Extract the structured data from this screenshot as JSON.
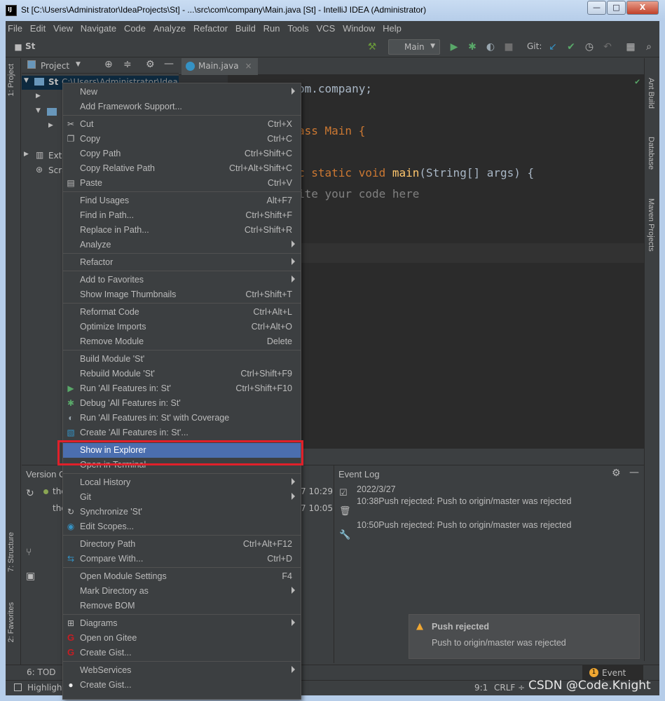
{
  "window": {
    "title": "St [C:\\Users\\Administrator\\IdeaProjects\\St] - ...\\src\\com\\company\\Main.java [St] - IntelliJ IDEA (Administrator)",
    "minimize": "—",
    "maximize": "□",
    "close": "X"
  },
  "menubar": [
    "File",
    "Edit",
    "View",
    "Navigate",
    "Code",
    "Analyze",
    "Refactor",
    "Build",
    "Run",
    "Tools",
    "VCS",
    "Window",
    "Help"
  ],
  "toolbar": {
    "project_name": "St",
    "run_config": "Main",
    "git_label": "Git:"
  },
  "left_stripe": {
    "project_tab": "1: Project",
    "structure_tab": "7: Structure",
    "favorites_tab": "2: Favorites"
  },
  "right_stripe": {
    "ant_build": "Ant Build",
    "database": "Database",
    "maven": "Maven Projects"
  },
  "project_pane": {
    "title": "Project",
    "root_label": "St",
    "root_path": "C:\\Users\\Administrator\\IdeaP",
    "external": "Exte",
    "scratches": "Scra"
  },
  "editor": {
    "tab_label": "Main.java",
    "line1": "om.company;",
    "line2": "ass Main {",
    "line3_a": "c static void ",
    "line3_fn": "main",
    "line3_b": "(String[] args) {",
    "line4": "ite your code here"
  },
  "vcs_pane": {
    "title": "Version C",
    "row1": "the",
    "row2": "the",
    "time1": "7 10:29",
    "time2": "7 10:05"
  },
  "event_log": {
    "title": "Event Log",
    "date": "2022/3/27",
    "entry1_time": "10:38",
    "entry1_msg": "Push rejected: Push to origin/master was rejected",
    "entry2_time": "10:50",
    "entry2_msg": "Push rejected: Push to origin/master was rejected"
  },
  "notification": {
    "title": "Push rejected",
    "message": "Push to origin/master was rejected"
  },
  "bottom_tabs": {
    "todo": "6: TOD",
    "event_log_badge": "1",
    "event_log": "Event Log"
  },
  "statusbar": {
    "highlight": "Highlight",
    "position": "9:1",
    "line_sep": "CRLF ÷"
  },
  "watermark": "CSDN @Code.Knight",
  "context_menu": {
    "items": [
      {
        "label": "New",
        "shortcut": "",
        "submenu": true,
        "icon": ""
      },
      {
        "label": "Add Framework Support...",
        "shortcut": "",
        "submenu": false,
        "icon": ""
      },
      {
        "label": "Cut",
        "shortcut": "Ctrl+X",
        "submenu": false,
        "icon": "scissors"
      },
      {
        "label": "Copy",
        "shortcut": "Ctrl+C",
        "submenu": false,
        "icon": "copy"
      },
      {
        "label": "Copy Path",
        "shortcut": "Ctrl+Shift+C",
        "submenu": false,
        "icon": ""
      },
      {
        "label": "Copy Relative Path",
        "shortcut": "Ctrl+Alt+Shift+C",
        "submenu": false,
        "icon": ""
      },
      {
        "label": "Paste",
        "shortcut": "Ctrl+V",
        "submenu": false,
        "icon": "paste"
      },
      {
        "label": "Find Usages",
        "shortcut": "Alt+F7",
        "submenu": false,
        "icon": ""
      },
      {
        "label": "Find in Path...",
        "shortcut": "Ctrl+Shift+F",
        "submenu": false,
        "icon": ""
      },
      {
        "label": "Replace in Path...",
        "shortcut": "Ctrl+Shift+R",
        "submenu": false,
        "icon": ""
      },
      {
        "label": "Analyze",
        "shortcut": "",
        "submenu": true,
        "icon": ""
      },
      {
        "label": "Refactor",
        "shortcut": "",
        "submenu": true,
        "icon": ""
      },
      {
        "label": "Add to Favorites",
        "shortcut": "",
        "submenu": true,
        "icon": ""
      },
      {
        "label": "Show Image Thumbnails",
        "shortcut": "Ctrl+Shift+T",
        "submenu": false,
        "icon": ""
      },
      {
        "label": "Reformat Code",
        "shortcut": "Ctrl+Alt+L",
        "submenu": false,
        "icon": ""
      },
      {
        "label": "Optimize Imports",
        "shortcut": "Ctrl+Alt+O",
        "submenu": false,
        "icon": ""
      },
      {
        "label": "Remove Module",
        "shortcut": "Delete",
        "submenu": false,
        "icon": ""
      },
      {
        "label": "Build Module 'St'",
        "shortcut": "",
        "submenu": false,
        "icon": ""
      },
      {
        "label": "Rebuild Module 'St'",
        "shortcut": "Ctrl+Shift+F9",
        "submenu": false,
        "icon": ""
      },
      {
        "label": "Run 'All Features in: St'",
        "shortcut": "Ctrl+Shift+F10",
        "submenu": false,
        "icon": "run"
      },
      {
        "label": "Debug 'All Features in: St'",
        "shortcut": "",
        "submenu": false,
        "icon": "debug"
      },
      {
        "label": "Run 'All Features in: St' with Coverage",
        "shortcut": "",
        "submenu": false,
        "icon": "coverage"
      },
      {
        "label": "Create 'All Features in: St'...",
        "shortcut": "",
        "submenu": false,
        "icon": "create"
      },
      {
        "label": "Show in Explorer",
        "shortcut": "",
        "submenu": false,
        "icon": "",
        "selected": true
      },
      {
        "label": "Open in Terminal",
        "shortcut": "",
        "submenu": false,
        "icon": ""
      },
      {
        "label": "Local History",
        "shortcut": "",
        "submenu": true,
        "icon": ""
      },
      {
        "label": "Git",
        "shortcut": "",
        "submenu": true,
        "icon": ""
      },
      {
        "label": "Synchronize 'St'",
        "shortcut": "",
        "submenu": false,
        "icon": "sync"
      },
      {
        "label": "Edit Scopes...",
        "shortcut": "",
        "submenu": false,
        "icon": "scope"
      },
      {
        "label": "Directory Path",
        "shortcut": "Ctrl+Alt+F12",
        "submenu": false,
        "icon": ""
      },
      {
        "label": "Compare With...",
        "shortcut": "Ctrl+D",
        "submenu": false,
        "icon": "compare"
      },
      {
        "label": "Open Module Settings",
        "shortcut": "F4",
        "submenu": false,
        "icon": ""
      },
      {
        "label": "Mark Directory as",
        "shortcut": "",
        "submenu": true,
        "icon": ""
      },
      {
        "label": "Remove BOM",
        "shortcut": "",
        "submenu": false,
        "icon": ""
      },
      {
        "label": "Diagrams",
        "shortcut": "",
        "submenu": true,
        "icon": "diagram"
      },
      {
        "label": "Open on Gitee",
        "shortcut": "",
        "submenu": false,
        "icon": "gitee"
      },
      {
        "label": "Create Gist...",
        "shortcut": "",
        "submenu": false,
        "icon": "gitee"
      },
      {
        "label": "WebServices",
        "shortcut": "",
        "submenu": true,
        "icon": ""
      },
      {
        "label": "Create Gist...",
        "shortcut": "",
        "submenu": false,
        "icon": "github"
      }
    ]
  },
  "colors": {
    "selection": "#4b6eaf",
    "highlight_box": "#e0202a",
    "background": "#3c3f41",
    "editor_bg": "#2b2b2b"
  }
}
